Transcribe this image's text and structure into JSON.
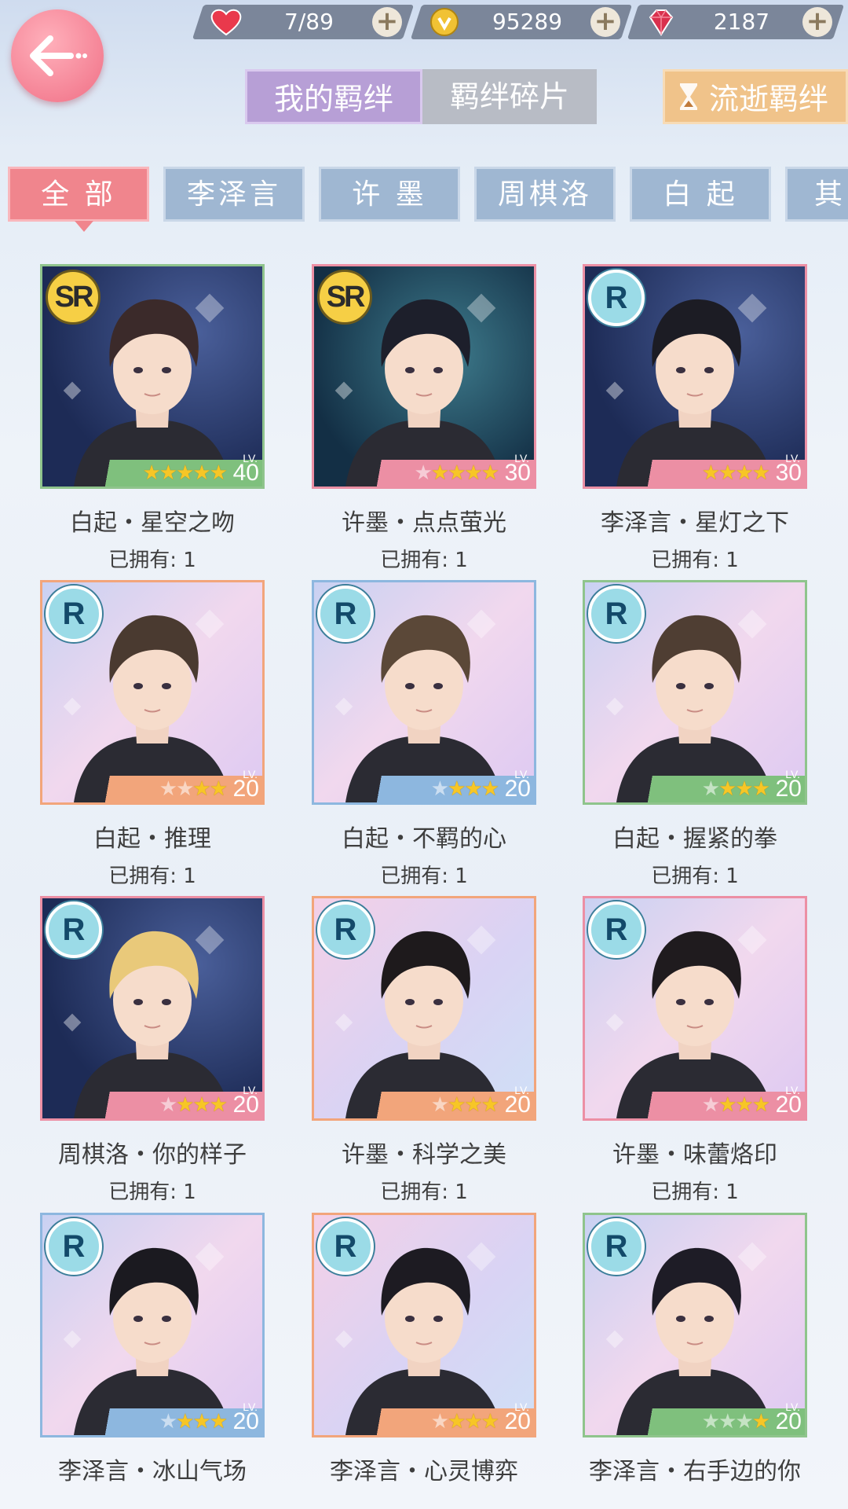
{
  "resources": [
    {
      "name": "stamina",
      "icon": "heart-icon",
      "value": "7/89"
    },
    {
      "name": "gold",
      "icon": "coin-icon",
      "value": "95289"
    },
    {
      "name": "diamond",
      "icon": "gem-icon",
      "value": "2187"
    }
  ],
  "main_tabs": {
    "my_bonds": "我的羁绊",
    "bond_fragments": "羁绊碎片",
    "lost_bonds": "流逝羁绊"
  },
  "filter_tabs": [
    "全 部",
    "李泽言",
    "许 墨",
    "周棋洛",
    "白 起",
    "其"
  ],
  "lv_label": "LV.",
  "cards": [
    {
      "name": "白起・星空之吻",
      "owned": "已拥有: 1",
      "rarity": "SR",
      "stars": 5,
      "max_stars": 5,
      "level": "40",
      "frame": "green",
      "bg": "night",
      "hair": "#3b2a2a"
    },
    {
      "name": "许墨・点点萤光",
      "owned": "已拥有: 1",
      "rarity": "SR",
      "stars": 4,
      "max_stars": 5,
      "level": "30",
      "frame": "pink",
      "bg": "teal",
      "hair": "#1d1f2b"
    },
    {
      "name": "李泽言・星灯之下",
      "owned": "已拥有: 1",
      "rarity": "R",
      "stars": 4,
      "max_stars": 4,
      "level": "30",
      "frame": "pink",
      "bg": "night",
      "hair": "#1c1c24"
    },
    {
      "name": "白起・推理",
      "owned": "已拥有: 1",
      "rarity": "R",
      "stars": 2,
      "max_stars": 4,
      "level": "20",
      "frame": "orange",
      "bg": "pastel",
      "hair": "#4a3a30"
    },
    {
      "name": "白起・不羁的心",
      "owned": "已拥有: 1",
      "rarity": "R",
      "stars": 3,
      "max_stars": 4,
      "level": "20",
      "frame": "blue",
      "bg": "pastel",
      "hair": "#5b4838"
    },
    {
      "name": "白起・握紧的拳",
      "owned": "已拥有: 1",
      "rarity": "R",
      "stars": 3,
      "max_stars": 4,
      "level": "20",
      "frame": "green",
      "bg": "pastel",
      "hair": "#4f3e33"
    },
    {
      "name": "周棋洛・你的样子",
      "owned": "已拥有: 1",
      "rarity": "R",
      "stars": 3,
      "max_stars": 4,
      "level": "20",
      "frame": "pink",
      "bg": "night",
      "hair": "#e9c97a"
    },
    {
      "name": "许墨・科学之美",
      "owned": "已拥有: 1",
      "rarity": "R",
      "stars": 3,
      "max_stars": 4,
      "level": "20",
      "frame": "orange",
      "bg": "pastel2",
      "hair": "#1e1a1c"
    },
    {
      "name": "许墨・味蕾烙印",
      "owned": "已拥有: 1",
      "rarity": "R",
      "stars": 3,
      "max_stars": 4,
      "level": "20",
      "frame": "pink",
      "bg": "pastel",
      "hair": "#1f1b1e"
    },
    {
      "name": "李泽言・冰山气场",
      "owned": "",
      "rarity": "R",
      "stars": 3,
      "max_stars": 4,
      "level": "20",
      "frame": "blue",
      "bg": "pastel",
      "hair": "#1b1a20"
    },
    {
      "name": "李泽言・心灵博弈",
      "owned": "",
      "rarity": "R",
      "stars": 3,
      "max_stars": 4,
      "level": "20",
      "frame": "orange",
      "bg": "pastel2",
      "hair": "#1d1b22"
    },
    {
      "name": "李泽言・右手边的你",
      "owned": "",
      "rarity": "R",
      "stars": 1,
      "max_stars": 4,
      "level": "20",
      "frame": "green",
      "bg": "pastel",
      "hair": "#1e1c26"
    }
  ]
}
